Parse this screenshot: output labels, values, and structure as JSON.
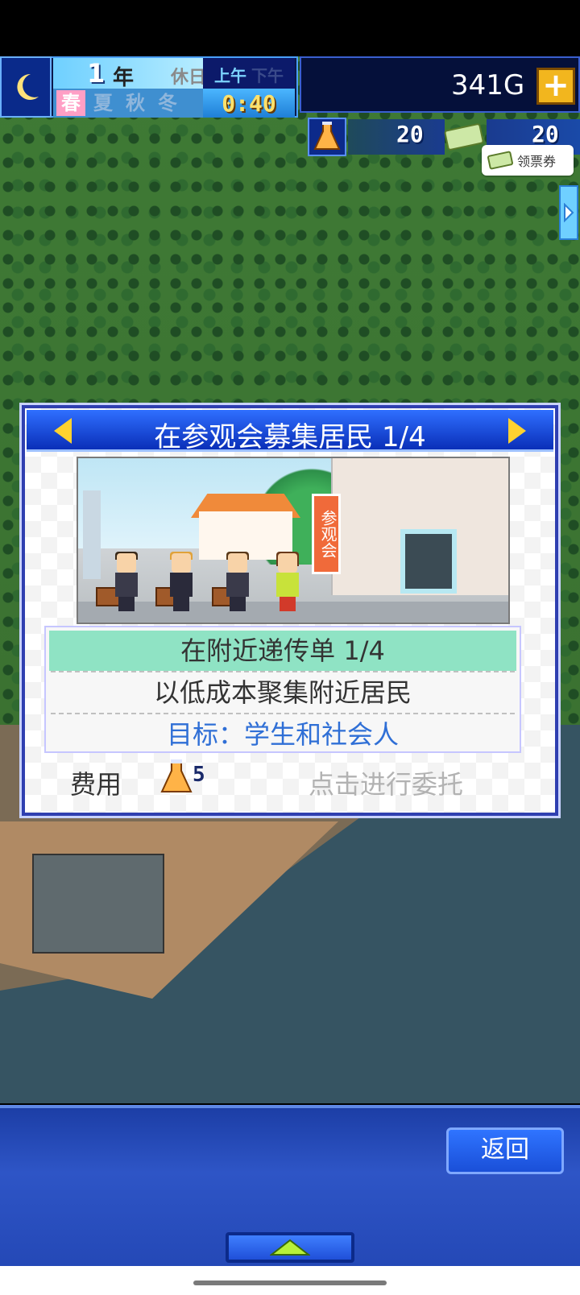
{
  "hud": {
    "year_number": "1",
    "year_unit": "年",
    "holiday": "休日",
    "am": "上午",
    "pm": "下午",
    "seasons": [
      "春",
      "夏",
      "秋",
      "冬"
    ],
    "active_season": "春",
    "time": "0:40",
    "money": "341G",
    "research_points": "20",
    "tickets": "20",
    "coupon_label": "领票券"
  },
  "dialog": {
    "title": "在参观会募集居民 1/4",
    "banner_text": "参观会",
    "option_title": "在附近递传单 1/4",
    "description": "以低成本聚集附近居民",
    "target": "目标：学生和社会人",
    "cost_label": "费用",
    "cost_value": "5",
    "commission_label": "点击进行委托"
  },
  "bottom": {
    "return_label": "返回"
  },
  "colors": {
    "accent_blue": "#2f6fff",
    "gold": "#ffd230",
    "highlight_row": "#8fe3c4",
    "target_text": "#2f6fd6"
  }
}
